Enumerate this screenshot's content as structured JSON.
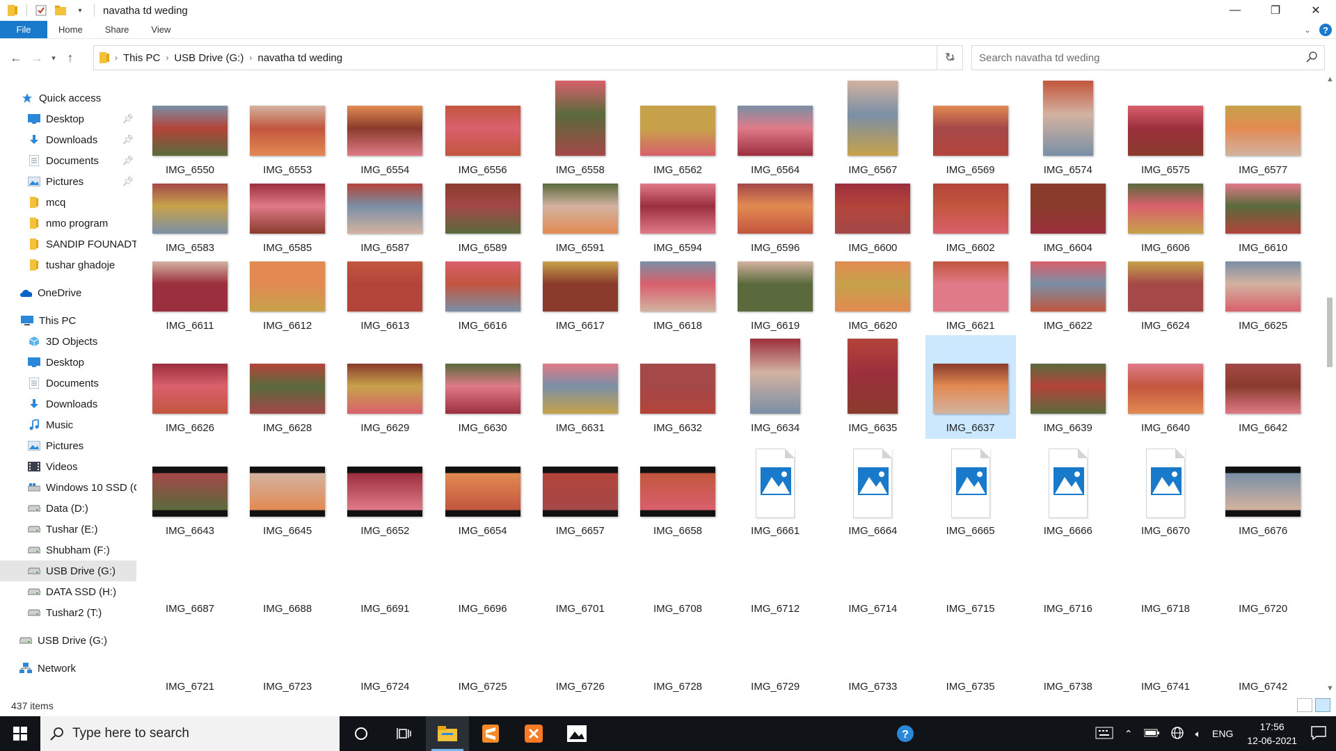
{
  "window": {
    "title": "navatha td weding",
    "controls": {
      "minimize": "—",
      "maximize": "❐",
      "close": "✕"
    }
  },
  "ribbon": {
    "tabs": [
      "File",
      "Home",
      "Share",
      "View"
    ],
    "help": "?"
  },
  "address": {
    "crumbs": [
      "This PC",
      "USB Drive (G:)",
      "navatha td weding"
    ],
    "search_placeholder": "Search navatha td weding"
  },
  "sidebar": {
    "quick_access": {
      "label": "Quick access",
      "items": [
        {
          "label": "Desktop",
          "icon": "desktop-folder-icon",
          "pinned": true
        },
        {
          "label": "Downloads",
          "icon": "downloads-icon",
          "pinned": true
        },
        {
          "label": "Documents",
          "icon": "documents-icon",
          "pinned": true
        },
        {
          "label": "Pictures",
          "icon": "pictures-icon",
          "pinned": true
        },
        {
          "label": "mcq",
          "icon": "folder-icon",
          "pinned": false
        },
        {
          "label": "nmo program",
          "icon": "folder-icon",
          "pinned": false
        },
        {
          "label": "SANDIP FOUNADTI(",
          "icon": "folder-icon",
          "pinned": false
        },
        {
          "label": "tushar ghadoje",
          "icon": "folder-icon",
          "pinned": false
        }
      ]
    },
    "onedrive": "OneDrive",
    "this_pc": {
      "label": "This PC",
      "items": [
        {
          "label": "3D Objects",
          "icon": "3d-objects-icon"
        },
        {
          "label": "Desktop",
          "icon": "desktop-folder-icon"
        },
        {
          "label": "Documents",
          "icon": "documents-icon"
        },
        {
          "label": "Downloads",
          "icon": "downloads-icon"
        },
        {
          "label": "Music",
          "icon": "music-icon"
        },
        {
          "label": "Pictures",
          "icon": "pictures-icon"
        },
        {
          "label": "Videos",
          "icon": "videos-icon"
        },
        {
          "label": "Windows 10 SSD (C",
          "icon": "windows-drive-icon"
        },
        {
          "label": "Data (D:)",
          "icon": "drive-icon"
        },
        {
          "label": "Tushar (E:)",
          "icon": "drive-icon"
        },
        {
          "label": "Shubham (F:)",
          "icon": "drive-icon"
        },
        {
          "label": "USB Drive (G:)",
          "icon": "usb-drive-icon",
          "selected": true
        },
        {
          "label": "DATA SSD (H:)",
          "icon": "drive-icon"
        },
        {
          "label": "Tushar2 (T:)",
          "icon": "drive-icon"
        }
      ]
    },
    "usb": "USB Drive (G:)",
    "network": "Network"
  },
  "files": {
    "rows": [
      [
        "IMG_6550",
        "IMG_6553",
        "IMG_6554",
        "IMG_6556",
        "IMG_6558",
        "IMG_6562",
        "IMG_6564",
        "IMG_6567",
        "IMG_6569",
        "IMG_6574",
        "IMG_6575",
        "IMG_6577"
      ],
      [
        "IMG_6583",
        "IMG_6585",
        "IMG_6587",
        "IMG_6589",
        "IMG_6591",
        "IMG_6594",
        "IMG_6596",
        "IMG_6600",
        "IMG_6602",
        "IMG_6604",
        "IMG_6606",
        "IMG_6610"
      ],
      [
        "IMG_6611",
        "IMG_6612",
        "IMG_6613",
        "IMG_6616",
        "IMG_6617",
        "IMG_6618",
        "IMG_6619",
        "IMG_6620",
        "IMG_6621",
        "IMG_6622",
        "IMG_6624",
        "IMG_6625"
      ],
      [
        "IMG_6626",
        "IMG_6628",
        "IMG_6629",
        "IMG_6630",
        "IMG_6631",
        "IMG_6632",
        "IMG_6634",
        "IMG_6635",
        "IMG_6637",
        "IMG_6639",
        "IMG_6640",
        "IMG_6642"
      ],
      [
        "IMG_6643",
        "IMG_6645",
        "IMG_6652",
        "IMG_6654",
        "IMG_6657",
        "IMG_6658",
        "IMG_6661",
        "IMG_6664",
        "IMG_6665",
        "IMG_6666",
        "IMG_6670",
        "IMG_6676"
      ],
      [
        "IMG_6687",
        "IMG_6688",
        "IMG_6691",
        "IMG_6696",
        "IMG_6701",
        "IMG_6708",
        "IMG_6712",
        "IMG_6714",
        "IMG_6715",
        "IMG_6716",
        "IMG_6718",
        "IMG_6720"
      ],
      [
        "IMG_6721",
        "IMG_6723",
        "IMG_6724",
        "IMG_6725",
        "IMG_6726",
        "IMG_6728",
        "IMG_6729",
        "IMG_6733",
        "IMG_6735",
        "IMG_6738",
        "IMG_6741",
        "IMG_6742"
      ]
    ],
    "selected": "IMG_6637",
    "thumb_colors": [
      "#b3443a",
      "#c2563e",
      "#8a3b2c",
      "#d9606c",
      "#5a6a3c",
      "#c7a24a",
      "#e07a88",
      "#7a8fa6",
      "#a44848",
      "#d3b2a0",
      "#9c2f3d",
      "#e28a52"
    ]
  },
  "status": {
    "item_count": "437 items"
  },
  "taskbar": {
    "search_placeholder": "Type here to search",
    "lang": "ENG",
    "time": "17:56",
    "date": "12-06-2021"
  }
}
